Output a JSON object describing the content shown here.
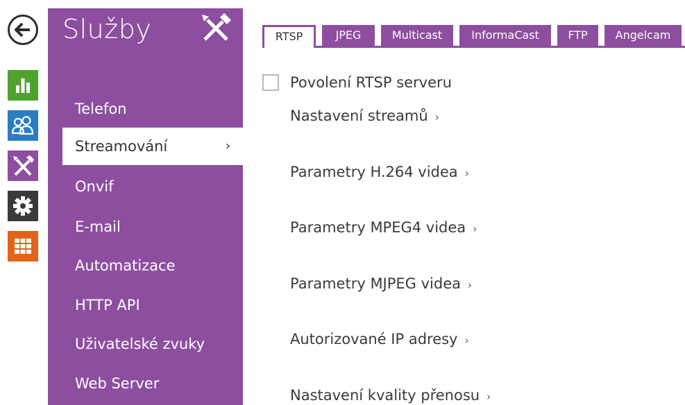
{
  "rail": {
    "items": [
      {
        "name": "back",
        "icon": "arrow-left-icon"
      },
      {
        "name": "status",
        "icon": "bar-chart-icon",
        "color": "#4ea32f"
      },
      {
        "name": "directory",
        "icon": "users-icon",
        "color": "#2a7cc3"
      },
      {
        "name": "services",
        "icon": "tools-icon",
        "color": "#8d4ea0"
      },
      {
        "name": "hardware",
        "icon": "gear-icon",
        "color": "#3a3a3a"
      },
      {
        "name": "system",
        "icon": "grid-icon",
        "color": "#e2631a"
      }
    ]
  },
  "sidebar": {
    "title": "Služby",
    "title_icon": "tools-icon",
    "items": [
      {
        "label": "Telefon"
      },
      {
        "label": "Streamování",
        "active": true,
        "chevron": "›"
      },
      {
        "label": "Onvif"
      },
      {
        "label": "E-mail"
      },
      {
        "label": "Automatizace"
      },
      {
        "label": "HTTP API"
      },
      {
        "label": "Uživatelské zvuky"
      },
      {
        "label": "Web Server"
      }
    ]
  },
  "tabs": [
    {
      "label": "RTSP",
      "active": true
    },
    {
      "label": "JPEG"
    },
    {
      "label": "Multicast"
    },
    {
      "label": "InformaCast"
    },
    {
      "label": "FTP"
    },
    {
      "label": "Angelcam"
    }
  ],
  "content": {
    "checkbox_label": "Povolení RTSP serveru",
    "checkbox_checked": false,
    "links": [
      {
        "label": "Nastavení streamů",
        "chevron": "›"
      },
      {
        "label": "Parametry H.264 videa",
        "chevron": "›"
      },
      {
        "label": "Parametry MPEG4 videa",
        "chevron": "›"
      },
      {
        "label": "Parametry MJPEG videa",
        "chevron": "›"
      },
      {
        "label": "Autorizované IP adresy",
        "chevron": "›"
      },
      {
        "label": "Nastavení kvality přenosu",
        "chevron": "›"
      }
    ]
  },
  "colors": {
    "accent": "#8d4ea0",
    "status": "#4ea32f",
    "directory": "#2a7cc3",
    "hardware": "#3a3a3a",
    "system": "#e2631a"
  }
}
